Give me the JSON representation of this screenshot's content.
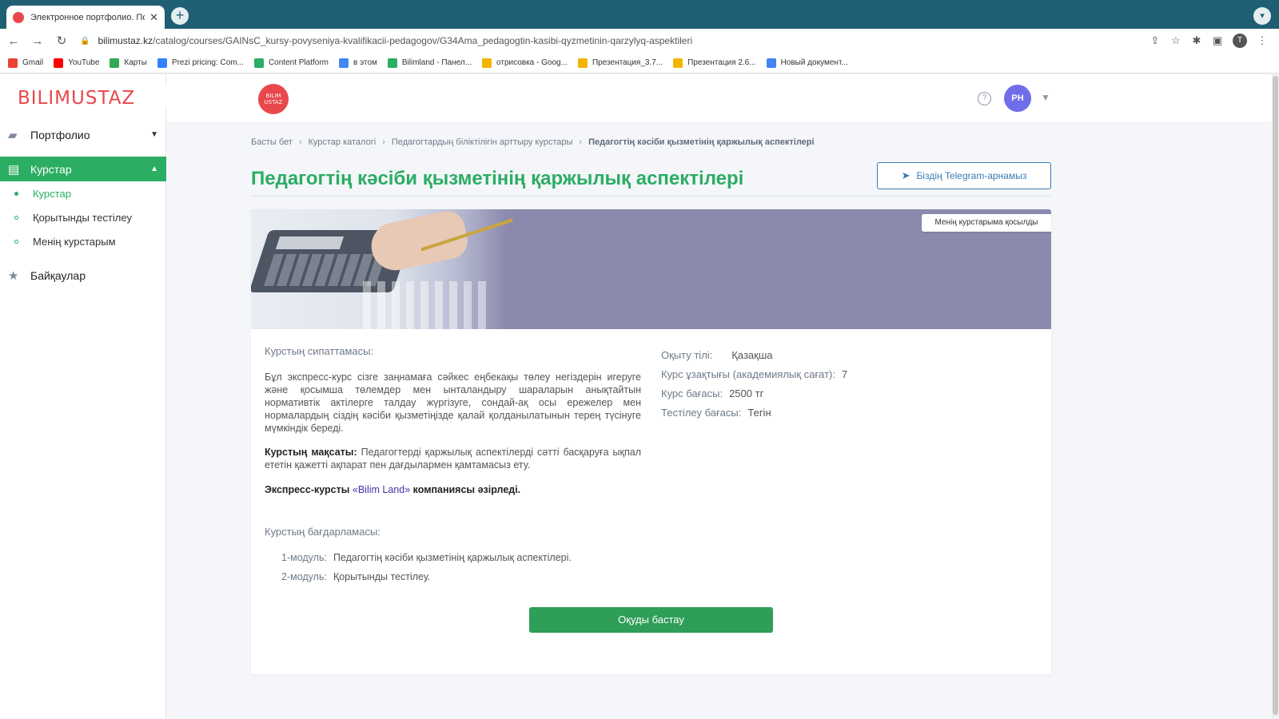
{
  "browser": {
    "tab_title": "Электронное портфолио. Пор",
    "url_host": "bilimustaz.kz",
    "url_path": "/catalog/courses/GAINsC_kursy-povyseniya-kvalifikacii-pedagogov/G34Ama_pedagogtin-kasibi-qyzmetinin-qarzylyq-aspektileri",
    "profile_initial": "T",
    "bookmarks": [
      {
        "label": "Gmail",
        "icon": "gmail-icon",
        "color": "#ea4335"
      },
      {
        "label": "YouTube",
        "icon": "youtube-icon",
        "color": "#ff0000"
      },
      {
        "label": "Карты",
        "icon": "maps-icon",
        "color": "#34a853"
      },
      {
        "label": "Prezi pricing: Com...",
        "icon": "prezi-icon",
        "color": "#3181ff"
      },
      {
        "label": "Content Platform",
        "icon": "platform-icon",
        "color": "#2bad63"
      },
      {
        "label": "в этом",
        "icon": "docs-icon",
        "color": "#4285f4"
      },
      {
        "label": "Bilimland - Панел...",
        "icon": "bilimland-icon",
        "color": "#2bad63"
      },
      {
        "label": "отрисовка - Goog...",
        "icon": "slides-icon",
        "color": "#f4b400"
      },
      {
        "label": "Презентация_3.7...",
        "icon": "slides-icon",
        "color": "#f4b400"
      },
      {
        "label": "Презентация 2.6...",
        "icon": "slides-icon",
        "color": "#f4b400"
      },
      {
        "label": "Новый документ...",
        "icon": "docs-icon",
        "color": "#4285f4"
      }
    ]
  },
  "sidebar": {
    "logo": "BILIMUSTAZ",
    "items": [
      {
        "label": "Портфолио",
        "icon": "briefcase-icon"
      },
      {
        "label": "Курстар",
        "icon": "book-icon"
      },
      {
        "label": "Байқаулар",
        "icon": "star-icon"
      }
    ],
    "subitems": [
      {
        "label": "Курстар"
      },
      {
        "label": "Қорытынды тестілеу"
      },
      {
        "label": "Менің курстарым"
      }
    ]
  },
  "header": {
    "logo_line1": "BILIM",
    "logo_line2": "USTAZ",
    "avatar_initials": "PH"
  },
  "breadcrumb": [
    "Басты бет",
    "Курстар каталогі",
    "Педагогтардың біліктілігін арттыру курстары",
    "Педагогтің кәсіби қызметінің қаржылық аспектілері"
  ],
  "page": {
    "title": "Педагогтің кәсіби қызметінің қаржылық аспектілері",
    "telegram_button": "Біздің Telegram-арнамыз",
    "added_badge": "Менің курстарыма қосылды"
  },
  "course": {
    "description_label": "Курстың сипаттамасы:",
    "description": "Бұл экспресс-курс сізге заңнамаға сәйкес еңбекақы төлеу негіздерін игеруге және қосымша төлемдер мен ынталандыру шараларын анықтайтын нормативтік актілерге талдау жүргізуге, сондай-ақ осы ережелер мен нормалардың сіздің кәсіби қызметіңізде қалай қолданылатынын терең түсінуге мүмкіндік береді.",
    "goal_label": "Курстың мақсаты:",
    "goal": "Педагогтерді қаржылық аспектілерді сәтті басқаруға ықпал ететін қажетті ақпарат пен дағдылармен қамтамасыз ету.",
    "developer_prefix": "Экспресс-курсты",
    "developer_name": "«Bilim Land»",
    "developer_suffix": "компаниясы әзірледі.",
    "meta": [
      {
        "label": "Оқыту тілі:",
        "value": "Қазақша"
      },
      {
        "label": "Курс ұзақтығы (академиялық сағат):",
        "value": "7"
      },
      {
        "label": "Курс бағасы:",
        "value": "2500 тг"
      },
      {
        "label": "Тестілеу бағасы:",
        "value": "Тегін"
      }
    ],
    "program_label": "Курстың бағдарламасы:",
    "modules": [
      {
        "num": "1-модуль:",
        "title": "Педагогтің кәсіби қызметінің қаржылық аспектілері."
      },
      {
        "num": "2-модуль:",
        "title": "Қорытынды тестілеу."
      }
    ],
    "start_button": "Оқуды бастау"
  },
  "colors": {
    "brand_green": "#2bad63",
    "brand_red": "#e8474c",
    "telegram_blue": "#3a7bb5",
    "banner": "#8b8aae"
  }
}
